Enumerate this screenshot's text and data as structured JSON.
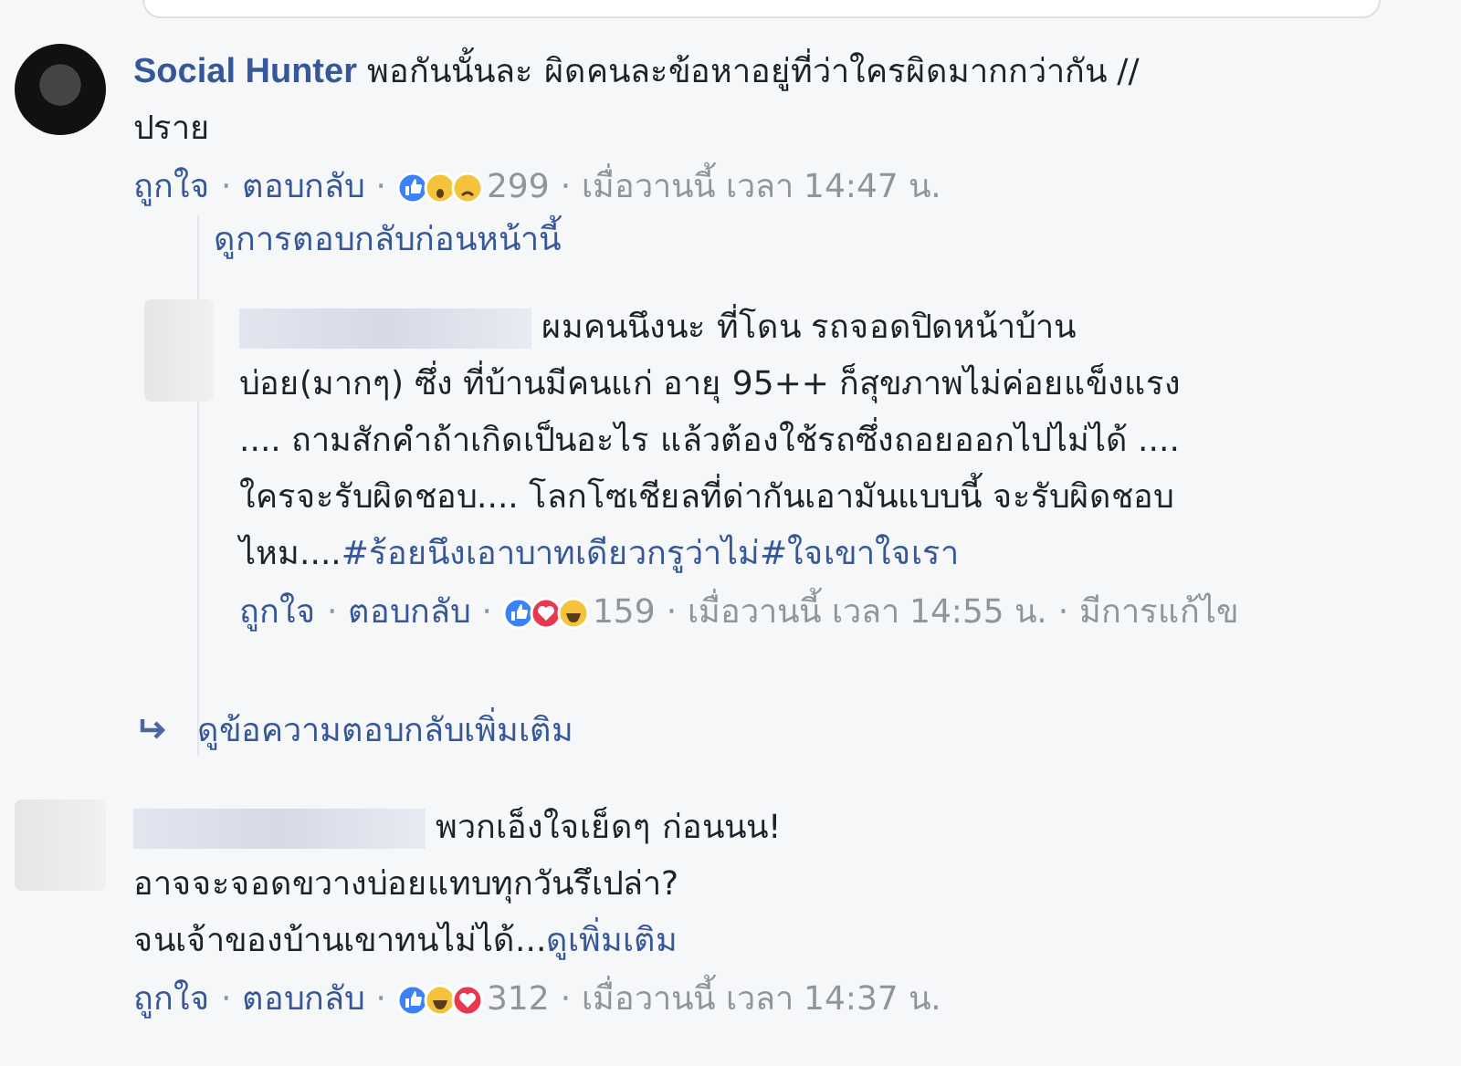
{
  "comments": [
    {
      "author": "Social Hunter",
      "author_hidden": false,
      "text": "พอกันนั้นละ ผิดคนละข้อหาอยู่ที่ว่าใครผิดมากกว่ากัน //\nปราย",
      "like": "ถูกใจ",
      "separator": "·",
      "reply": "ตอบกลับ",
      "reactions": [
        {
          "kind": "like"
        },
        {
          "kind": "wow"
        },
        {
          "kind": "sad"
        }
      ],
      "count": "299",
      "time": "เมื่อวานนี้ เวลา 14:47 น.",
      "previous_link": "ดูการตอบกลับก่อนหน้านี้",
      "replies": [
        {
          "author_hidden": true,
          "text": "ผมคนนึงนะ ที่โดน รถจอดปิดหน้าบ้าน\nบ่อย(มากๆ) ซึ่ง ที่บ้านมีคนแก่ อายุ 95++ ก็สุขภาพไม่ค่อยแข็งแรง\n.... ถามสักคำถ้าเกิดเป็นอะไร แล้วต้องใช้รถซึ่งถอยออกไปไม่ได้ ....\nใครจะรับผิดชอบ.... โลกโซเชียลที่ด่ากันเอามันแบบนี้ จะรับผิดชอบ\nไหม....",
          "hashtags": [
            "#ร้อยนึงเอาบาทเดียวกรูว่าไม่",
            "#ใจเขาใจเรา"
          ],
          "like": "ถูกใจ",
          "separator": "·",
          "reply": "ตอบกลับ",
          "reactions": [
            {
              "kind": "like"
            },
            {
              "kind": "love"
            },
            {
              "kind": "haha"
            }
          ],
          "count": "159",
          "time": "เมื่อวานนี้ เวลา 14:55 น.",
          "edited": "มีการแก้ไข"
        }
      ],
      "more_link": "ดูข้อความตอบกลับเพิ่มเติม"
    },
    {
      "author_hidden": true,
      "text": "พวกเอ็งใจเย็ดๆ ก่อนนน!\nอาจจะจอดขวางบ่อยแทบทุกวันรึเปล่า?\nจนเจ้าของบ้านเขาทนไม่ได้...",
      "see_more": "ดูเพิ่มเติม",
      "like": "ถูกใจ",
      "separator": "·",
      "reply": "ตอบกลับ",
      "reactions": [
        {
          "kind": "like"
        },
        {
          "kind": "haha"
        },
        {
          "kind": "love"
        }
      ],
      "count": "312",
      "time": "เมื่อวานนี้ เวลา 14:37 น."
    }
  ]
}
